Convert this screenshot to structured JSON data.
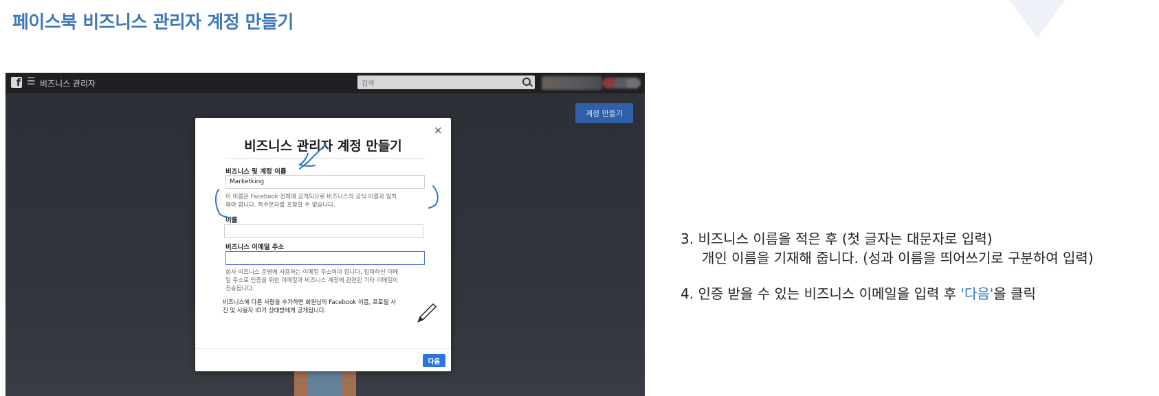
{
  "slide": {
    "title": "페이스북 비즈니스 관리자 계정 만들기"
  },
  "fb_header": {
    "logo_letter": "f",
    "menu_glyph": "☰",
    "app_name": "비즈니스 관리자",
    "search_placeholder": "검색"
  },
  "page": {
    "create_account_button": "계정 만들기"
  },
  "modal": {
    "close_glyph": "×",
    "title": "비즈니스 관리자 계정 만들기",
    "business_name_label": "비즈니스 및 계정 이름",
    "business_name_value": "Marketking",
    "business_name_help_1": "이 이름은 Facebook 전체에 공개되므로 비즈니스의 공식 이름과 일치",
    "business_name_help_2": "해야 합니다. 특수문자를 포함할 수 없습니다.",
    "name_label": "이름",
    "name_value": "",
    "email_label": "비즈니스 이메일 주소",
    "email_value": "",
    "email_help_1": "회사 비즈니스 운영에 사용하는 이메일 주소여야 합니다. 입력하신 이메",
    "email_help_2": "일 주소로 인증을 위한 이메일과 비즈니스 계정에 관련된 기타 이메일이",
    "email_help_3": "전송됩니다.",
    "privacy_note_1": "비즈니스에 다른 사람을 추가하면 회원님의 Facebook 이름, 프로필 사",
    "privacy_note_2": "진 및 사용자 ID가 상대방에게 공개됩니다.",
    "next_button": "다음"
  },
  "instructions": {
    "step3_line1": "3. 비즈니스 이름을 적은 후 (첫 글자는 대문자로 입력)",
    "step3_line2": "개인 이름을 기재해 줍니다. (성과 이름을 띄어쓰기로 구분하여 입력)",
    "step4_prefix": "4. 인증 받을 수 있는 비즈니스 이메일을 입력 후 ",
    "step4_highlight": "'다음'",
    "step4_suffix": "을 클릭"
  },
  "colors": {
    "title_blue": "#3f78b8",
    "fb_button_blue": "#2f5fa8",
    "next_button_blue": "#2d74e0",
    "annotation_blue": "#2f74d0",
    "highlight_blue": "#2a73c7"
  }
}
